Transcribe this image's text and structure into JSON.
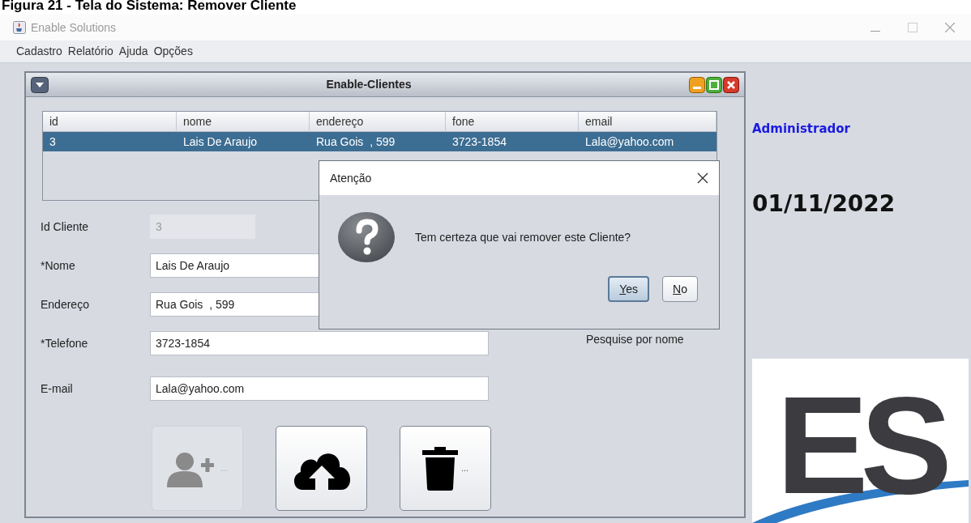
{
  "caption": "Figura 21 - Tela do Sistema: Remover Cliente",
  "window": {
    "title": "Enable Solutions"
  },
  "menu": [
    "Cadastro",
    "Relatório",
    "Ajuda",
    "Opções"
  ],
  "internal_frame": {
    "title": "Enable-Clientes"
  },
  "table": {
    "columns": [
      "id",
      "nome",
      "endereço",
      "fone",
      "email"
    ],
    "rows": [
      {
        "cells": [
          "3",
          "Lais De Araujo",
          "Rua Gois  , 599",
          "3723-1854",
          "Lala@yahoo.com"
        ],
        "selected": true
      }
    ]
  },
  "form": {
    "fields": [
      {
        "label": "Id Cliente",
        "value": "3",
        "disabled": true
      },
      {
        "label": "*Nome",
        "value": "Lais De Araujo",
        "disabled": false
      },
      {
        "label": "Endereço",
        "value": "Rua Gois  , 599",
        "disabled": false
      },
      {
        "label": "*Telefone",
        "value": "3723-1854",
        "disabled": false
      },
      {
        "label": "E-mail",
        "value": "Lala@yahoo.com",
        "disabled": false
      }
    ]
  },
  "search_label": "Pesquise por nome",
  "buttons": [
    {
      "kind": "add-user",
      "label": "...",
      "disabled": true
    },
    {
      "kind": "upload",
      "disabled": false
    },
    {
      "kind": "delete",
      "label": "...",
      "disabled": false
    }
  ],
  "dialog": {
    "title": "Atenção",
    "message": "Tem certeza que vai remover este Cliente?",
    "buttons": [
      {
        "label": "Yes",
        "selected": true
      },
      {
        "label": "No",
        "selected": false
      }
    ]
  },
  "sidebar": {
    "user": "Administrador",
    "date": "01/11/2022"
  },
  "logo": {
    "text": "ES"
  }
}
